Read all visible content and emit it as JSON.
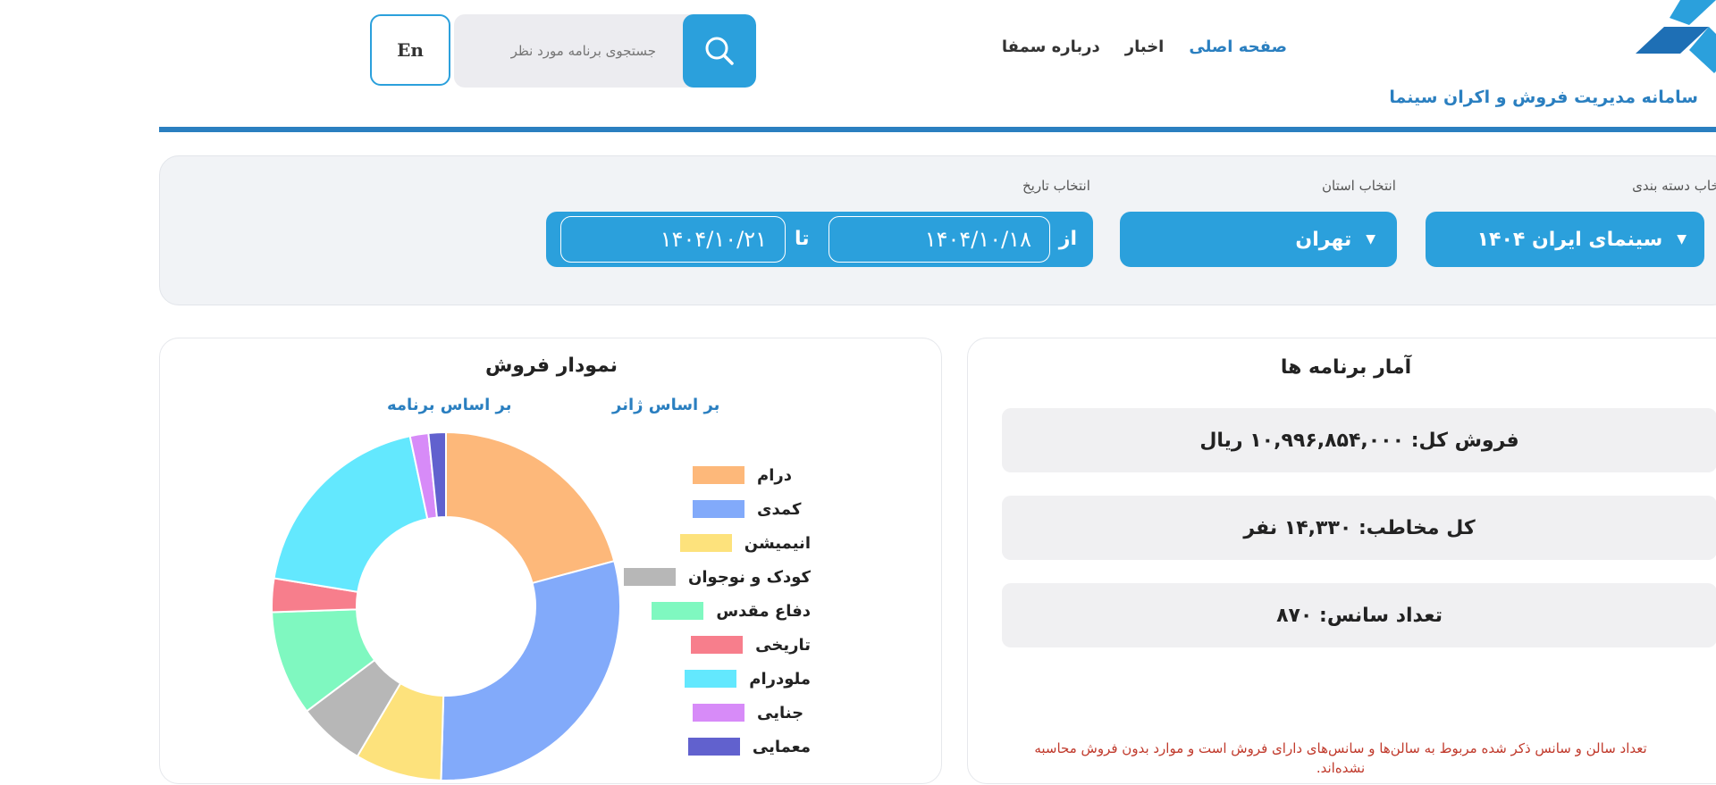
{
  "header": {
    "site_title": "سامانه مدیریت فروش و اکران سینما",
    "nav": [
      {
        "label": "صفحه اصلی",
        "active": true
      },
      {
        "label": "اخبار",
        "active": false
      },
      {
        "label": "درباره سمفا",
        "active": false
      }
    ],
    "search_placeholder": "جستجوی برنامه مورد نظر",
    "lang_button": "En"
  },
  "filters": {
    "category_label": "انتخاب دسته بندی",
    "category_value": "سینمای ایران ۱۴۰۴",
    "province_label": "انتخاب استان",
    "province_value": "تهران",
    "date_label": "انتخاب تاریخ",
    "from_word": "از",
    "from_date": "۱۴۰۴/۱۰/۱۸",
    "to_word": "تا",
    "to_date": "۱۴۰۴/۱۰/۲۱"
  },
  "stats": {
    "title": "آمار برنامه ها",
    "total_sales": "فروش کل: ۱۰,۹۹۶,۸۵۴,۰۰۰ ریال",
    "total_audience": "کل مخاطب: ۱۴,۳۳۰ نفر",
    "sessions": "تعداد سانس: ۸۷۰",
    "note": "تعداد سالن و سانس ذکر شده مربوط به سالن‌ها و سانس‌های دارای فروش است و موارد بدون فروش محاسبه نشده‌اند."
  },
  "chart": {
    "title": "نمودار فروش",
    "tab_genre": "بر اساس ژانر",
    "tab_program": "بر اساس برنامه"
  },
  "chart_data": {
    "type": "pie",
    "donut": true,
    "title": "نمودار فروش",
    "legend_position": "left",
    "categories": [
      "درام",
      "کمدی",
      "انیمیشن",
      "کودک و نوجوان",
      "دفاع مقدس",
      "تاریخی",
      "ملودرام",
      "جنایی",
      "معمایی"
    ],
    "values": [
      20.7,
      29.5,
      8.0,
      6.2,
      9.7,
      3.1,
      19.0,
      1.7,
      1.6
    ],
    "colors": [
      "#FDB87A",
      "#82AAFA",
      "#FDE27C",
      "#B7B7B7",
      "#7FF8C0",
      "#F77E8C",
      "#63E8FE",
      "#D78BF8",
      "#6161CE"
    ]
  }
}
